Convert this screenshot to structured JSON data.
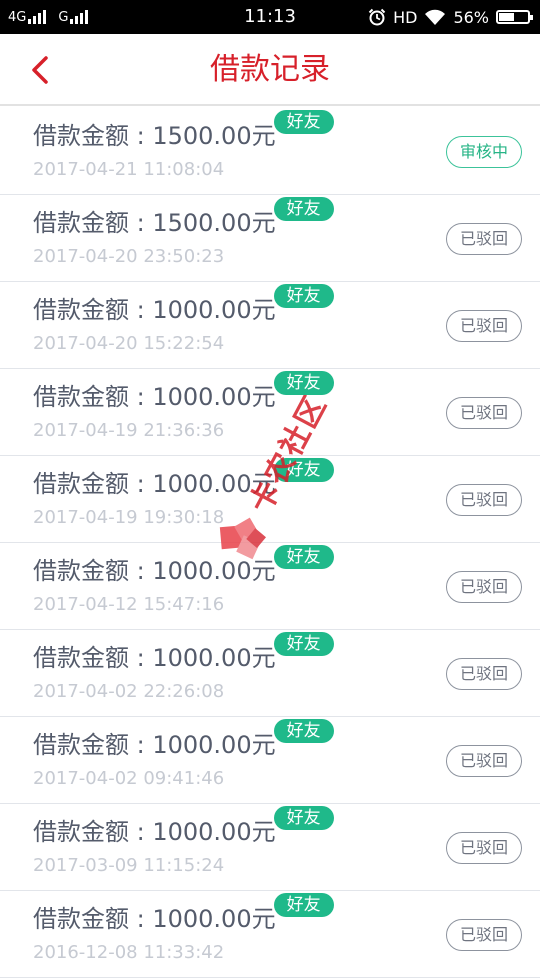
{
  "status_bar": {
    "network_1": "4G",
    "network_2": "G",
    "time": "11:13",
    "hd": "HD",
    "battery_percent": "56%",
    "battery_level": 0.56
  },
  "header": {
    "title": "借款记录",
    "back_icon": "chevron-left-icon"
  },
  "records": [
    {
      "amount": "借款金额 : 1500.00元",
      "badge": "好友",
      "date": "2017-04-21 11:08:04",
      "status": "审核中",
      "status_kind": "reviewing"
    },
    {
      "amount": "借款金额 : 1500.00元",
      "badge": "好友",
      "date": "2017-04-20 23:50:23",
      "status": "已驳回",
      "status_kind": "rejected"
    },
    {
      "amount": "借款金额 : 1000.00元",
      "badge": "好友",
      "date": "2017-04-20 15:22:54",
      "status": "已驳回",
      "status_kind": "rejected"
    },
    {
      "amount": "借款金额 : 1000.00元",
      "badge": "好友",
      "date": "2017-04-19 21:36:36",
      "status": "已驳回",
      "status_kind": "rejected"
    },
    {
      "amount": "借款金额 : 1000.00元",
      "badge": "好友",
      "date": "2017-04-19 19:30:18",
      "status": "已驳回",
      "status_kind": "rejected"
    },
    {
      "amount": "借款金额 : 1000.00元",
      "badge": "好友",
      "date": "2017-04-12 15:47:16",
      "status": "已驳回",
      "status_kind": "rejected"
    },
    {
      "amount": "借款金额 : 1000.00元",
      "badge": "好友",
      "date": "2017-04-02 22:26:08",
      "status": "已驳回",
      "status_kind": "rejected"
    },
    {
      "amount": "借款金额 : 1000.00元",
      "badge": "好友",
      "date": "2017-04-02 09:41:46",
      "status": "已驳回",
      "status_kind": "rejected"
    },
    {
      "amount": "借款金额 : 1000.00元",
      "badge": "好友",
      "date": "2017-03-09 11:15:24",
      "status": "已驳回",
      "status_kind": "rejected"
    },
    {
      "amount": "借款金额 : 1000.00元",
      "badge": "好友",
      "date": "2016-12-08 11:33:42",
      "status": "已驳回",
      "status_kind": "rejected"
    }
  ],
  "watermark": {
    "text": "卡农社区"
  },
  "colors": {
    "title_red": "#d7202a",
    "badge_green": "#1fb98a",
    "reviewing_green": "#26b486",
    "text_gray": "#545b6b"
  }
}
